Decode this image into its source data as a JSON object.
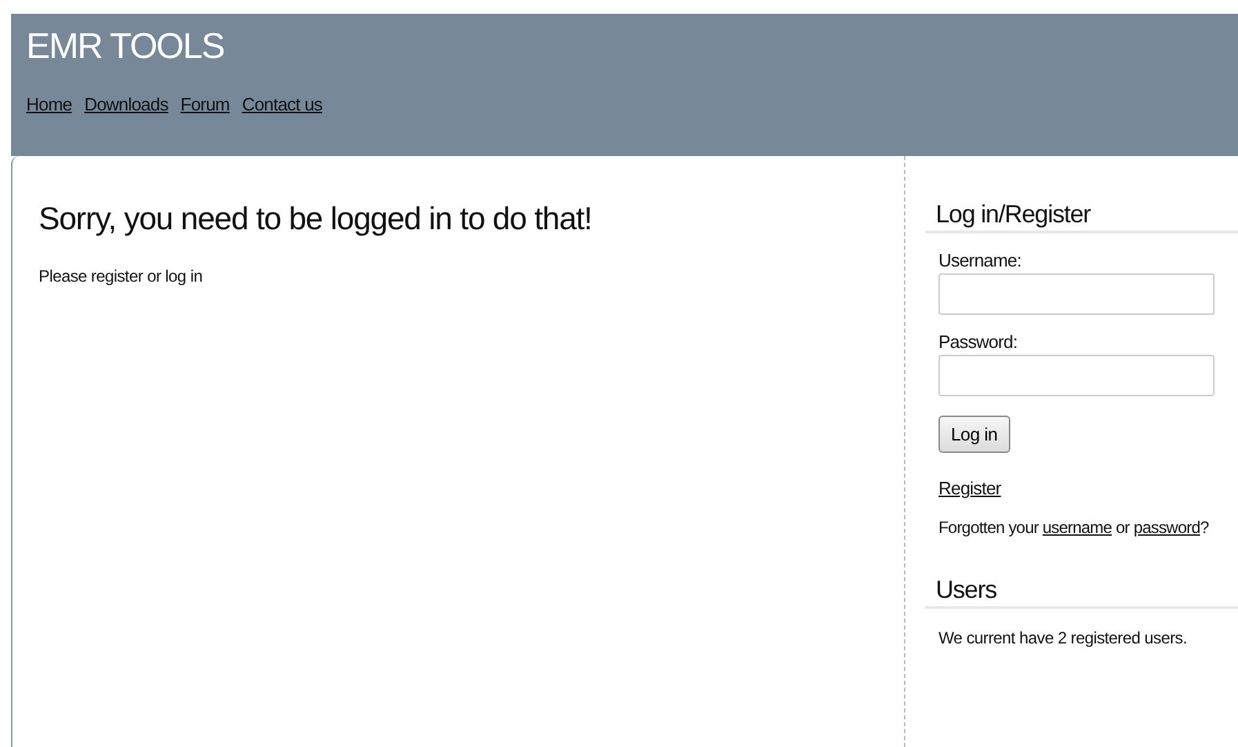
{
  "site": {
    "title": "EMR TOOLS",
    "nav": [
      "Home",
      "Downloads",
      "Forum",
      "Contact us"
    ]
  },
  "main": {
    "heading": "Sorry, you need to be logged in to do that!",
    "message": "Please register or log in"
  },
  "login": {
    "heading": "Log in/Register",
    "fields": [
      {
        "label": "Username:"
      },
      {
        "label": "Password:"
      }
    ],
    "button": "Log in",
    "register": "Register",
    "forgot": {
      "before": "Forgotten your ",
      "link1": "username",
      "middle": " or ",
      "link2": "password",
      "after": "?"
    }
  },
  "users": {
    "heading": "Users",
    "text": "We current have 2 registered users."
  }
}
